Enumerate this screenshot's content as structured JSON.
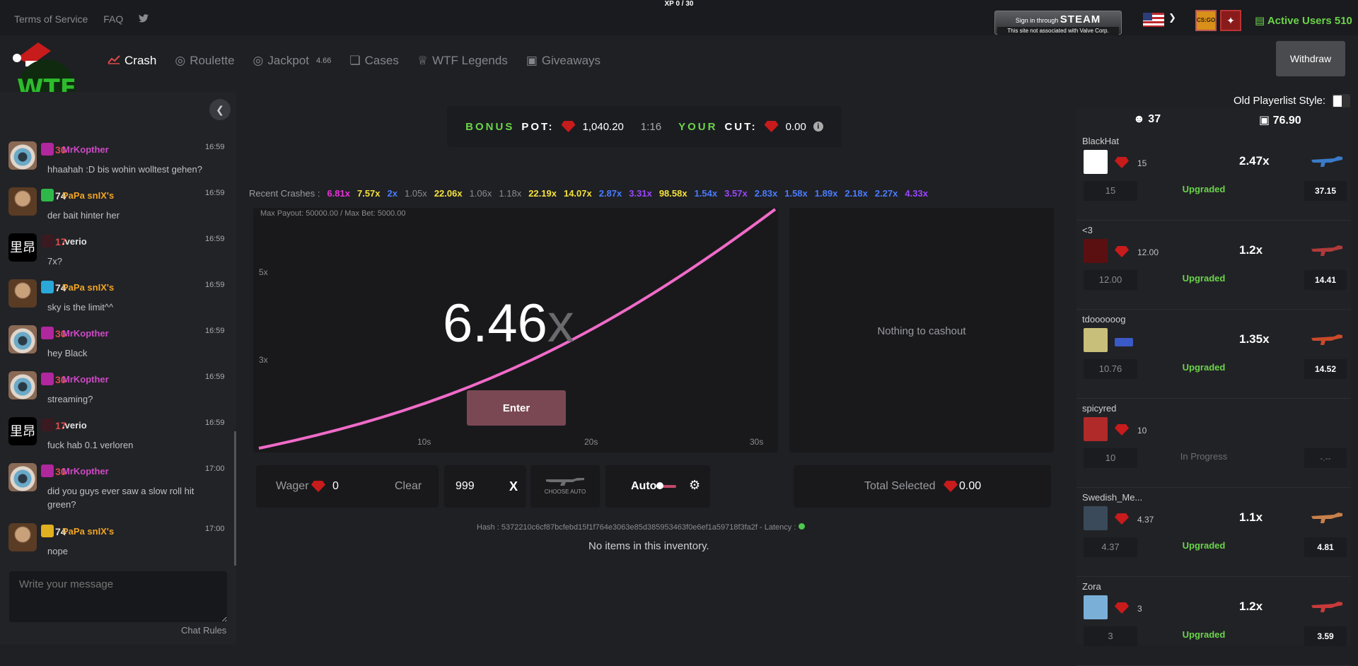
{
  "topbar": {
    "xp": "XP 0 / 30",
    "links": [
      "Terms of Service",
      "FAQ"
    ],
    "steam_line1_small": "Sign in through",
    "steam_line1_big": "STEAM",
    "steam_line2": "This site not associated with Valve Corp.",
    "game1_label": "CS:GO",
    "active_users_label": "Active Users",
    "active_users_count": "510"
  },
  "nav": {
    "items": [
      {
        "label": "Crash",
        "icon": "chart-line-icon"
      },
      {
        "label": "Roulette",
        "icon": "roulette-icon"
      },
      {
        "label": "Jackpot",
        "icon": "jackpot-icon",
        "badge": "4.66"
      },
      {
        "label": "Cases",
        "icon": "cube-icon"
      },
      {
        "label": "WTF Legends",
        "icon": "trophy-icon"
      },
      {
        "label": "Giveaways",
        "icon": "gift-icon"
      }
    ],
    "withdraw": "Withdraw"
  },
  "chat": {
    "messages": [
      {
        "level": "30",
        "user": "MrKopther",
        "time": "16:59",
        "text": "hhaahah :D bis wohin wolltest gehen?",
        "avatar": "eye",
        "rank_color": "#b0279e",
        "name_color": "#d049c6",
        "level_red": true
      },
      {
        "level": "74",
        "user": "PaPa snIX's",
        "time": "16:59",
        "text": "der bait hinter her",
        "avatar": "hat",
        "rank_color": "#2fb84a",
        "name_color": "#f1a524",
        "level_red": false
      },
      {
        "level": "17",
        "user": ".verio",
        "time": "16:59",
        "text": "7x?",
        "avatar": "kj",
        "rank_color": "#3a1a20",
        "name_color": "#e0e0e0",
        "level_red": true
      },
      {
        "level": "74",
        "user": "PaPa snIX's",
        "time": "16:59",
        "text": "sky is the limit^^",
        "avatar": "hat",
        "rank_color": "#2aa8d8",
        "name_color": "#f1a524",
        "level_red": false
      },
      {
        "level": "30",
        "user": "MrKopther",
        "time": "16:59",
        "text": "hey Black",
        "avatar": "eye",
        "rank_color": "#b0279e",
        "name_color": "#d049c6",
        "level_red": true
      },
      {
        "level": "30",
        "user": "MrKopther",
        "time": "16:59",
        "text": "streaming?",
        "avatar": "eye",
        "rank_color": "#b0279e",
        "name_color": "#d049c6",
        "level_red": true
      },
      {
        "level": "17",
        "user": ".verio",
        "time": "16:59",
        "text": "fuck hab 0.1 verloren",
        "avatar": "kj",
        "rank_color": "#3a1a20",
        "name_color": "#e0e0e0",
        "level_red": true
      },
      {
        "level": "30",
        "user": "MrKopther",
        "time": "17:00",
        "text": "did you guys ever saw a slow roll hit green?",
        "avatar": "eye",
        "rank_color": "#b0279e",
        "name_color": "#d049c6",
        "level_red": true
      },
      {
        "level": "74",
        "user": "PaPa snIX's",
        "time": "17:00",
        "text": "nope",
        "avatar": "hat",
        "rank_color": "#e0b020",
        "name_color": "#f1a524",
        "level_red": false
      }
    ],
    "avatar_glyph": "里昂",
    "input_placeholder": "Write your message",
    "rules": "Chat Rules"
  },
  "bonus": {
    "bonus_label": "BONUS",
    "pot_label": "POT:",
    "pot_value": "1,040.20",
    "timer": "1:16",
    "your_label": "YOUR",
    "cut_label": "CUT:",
    "cut_value": "0.00"
  },
  "recent": {
    "label": "Recent Crashes :",
    "items": [
      {
        "v": "6.81x",
        "c": "#e832d8"
      },
      {
        "v": "7.57x",
        "c": "#f5e23a"
      },
      {
        "v": "2x",
        "c": "#4a7cff"
      },
      {
        "v": "1.05x",
        "c": "#8a8b90"
      },
      {
        "v": "22.06x",
        "c": "#f5e23a"
      },
      {
        "v": "1.06x",
        "c": "#8a8b90"
      },
      {
        "v": "1.18x",
        "c": "#8a8b90"
      },
      {
        "v": "22.19x",
        "c": "#f5e23a"
      },
      {
        "v": "14.07x",
        "c": "#f5e23a"
      },
      {
        "v": "2.87x",
        "c": "#4a7cff"
      },
      {
        "v": "3.31x",
        "c": "#9b45ff"
      },
      {
        "v": "98.58x",
        "c": "#f5e23a"
      },
      {
        "v": "1.54x",
        "c": "#4a7cff"
      },
      {
        "v": "3.57x",
        "c": "#9b45ff"
      },
      {
        "v": "2.83x",
        "c": "#4a7cff"
      },
      {
        "v": "1.58x",
        "c": "#4a7cff"
      },
      {
        "v": "1.89x",
        "c": "#4a7cff"
      },
      {
        "v": "2.18x",
        "c": "#4a7cff"
      },
      {
        "v": "2.27x",
        "c": "#4a7cff"
      },
      {
        "v": "4.33x",
        "c": "#9b45ff"
      }
    ]
  },
  "game": {
    "max_payout": "Max Payout: 50000.00 / Max Bet: 5000.00",
    "multiplier": "6.46",
    "multiplier_suffix": "x",
    "y_labels": [
      "5x",
      "3x"
    ],
    "x_labels": [
      "10s",
      "20s",
      "30s"
    ],
    "enter": "Enter",
    "nothing": "Nothing to cashout",
    "curve_color": "#f06bc8"
  },
  "controls": {
    "wager_label": "Wager",
    "wager_value": "0",
    "clear": "Clear",
    "auto_cashout_value": "999",
    "x_label": "X",
    "choose_auto": "CHOOSE AUTO",
    "auto_label": "Auto",
    "total_selected_label": "Total Selected",
    "total_selected_value": "0.00"
  },
  "hash": {
    "text": "Hash : 5372210c6cf87bcfebd15f1f764e3063e85d385953463f0e6ef1a59718f3fa2f - Latency :",
    "noitems": "No items in this inventory."
  },
  "players": {
    "old_style_label": "Old Playerlist Style:",
    "count": "37",
    "total": "76.90",
    "list": [
      {
        "name": "BlackHat",
        "bet": "15",
        "mult": "2.47x",
        "box": "15",
        "status": "Upgraded",
        "value": "37.15",
        "avatar_bg": "#ffffff",
        "skin_color": "#3a7bc8",
        "in_progress": false
      },
      {
        "name": "<3",
        "bet": "12.00",
        "mult": "1.2x",
        "box": "12.00",
        "status": "Upgraded",
        "value": "14.41",
        "avatar_bg": "#5a1010",
        "skin_color": "#b03a3a",
        "in_progress": false
      },
      {
        "name": "tdoooooog",
        "bet": "",
        "mult": "1.35x",
        "box": "10.76",
        "status": "Upgraded",
        "value": "14.52",
        "avatar_bg": "#c8c07a",
        "skin_color": "#c84a2a",
        "in_progress": false
      },
      {
        "name": "spicyred",
        "bet": "10",
        "mult": "",
        "box": "10",
        "status": "In Progress",
        "value": "-.--",
        "avatar_bg": "#b02a2a",
        "skin_color": "",
        "in_progress": true
      },
      {
        "name": "Swedish_Me...",
        "bet": "4.37",
        "mult": "1.1x",
        "box": "4.37",
        "status": "Upgraded",
        "value": "4.81",
        "avatar_bg": "#3a4a5a",
        "skin_color": "#c8804a",
        "in_progress": false
      },
      {
        "name": "Zora",
        "bet": "3",
        "mult": "1.2x",
        "box": "3",
        "status": "Upgraded",
        "value": "3.59",
        "avatar_bg": "#7ab0d8",
        "skin_color": "#c83a3a",
        "in_progress": false
      }
    ]
  }
}
